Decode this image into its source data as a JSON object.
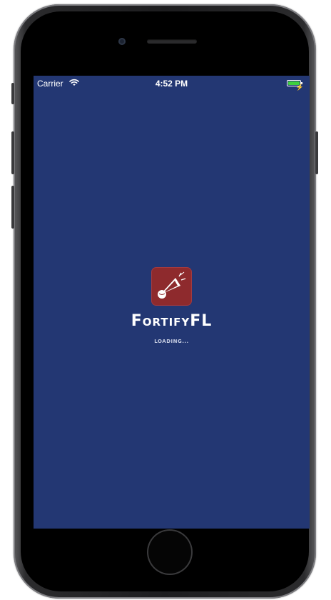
{
  "status_bar": {
    "carrier": "Carrier",
    "time": "4:52 PM",
    "wifi_icon": "wifi-icon",
    "battery_icon": "battery-charging-icon",
    "battery_level": 1.0,
    "battery_color": "#3ed13e"
  },
  "splash": {
    "app_name": "FortifyFL",
    "loading_text": "LOADING...",
    "logo_icon": "megaphone-icon",
    "background_color": "#233773",
    "logo_color": "#8e2a2d"
  }
}
